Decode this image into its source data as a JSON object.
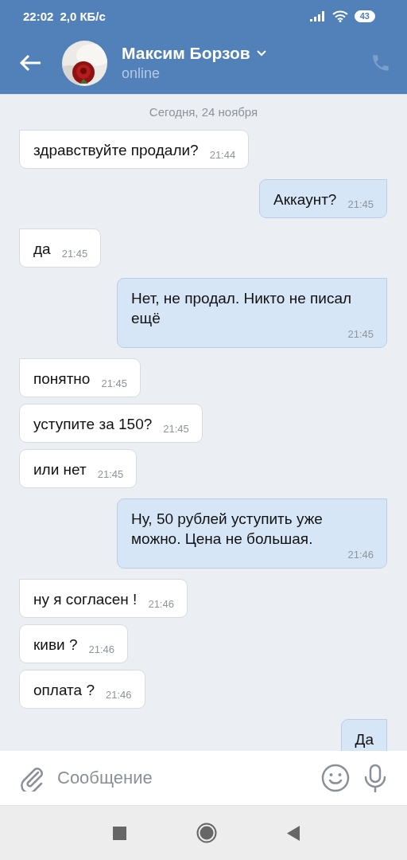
{
  "status_bar": {
    "time": "22:02",
    "speed": "2,0 КБ/с",
    "battery": "43"
  },
  "header": {
    "name": "Максим Борзов",
    "status": "online"
  },
  "date_separator": "Сегодня, 24 ноября",
  "messages": [
    {
      "kind": "incoming",
      "tail": true,
      "text": "здравствуйте продали?",
      "time": "21:44"
    },
    {
      "kind": "outgoing",
      "tail": true,
      "text": "Аккаунт?",
      "time": "21:45"
    },
    {
      "kind": "incoming",
      "tail": true,
      "text": "да",
      "time": "21:45"
    },
    {
      "kind": "outgoing",
      "tail": true,
      "text": "Нет, не продал. Никто не писал ещё",
      "time": "21:45"
    },
    {
      "kind": "incoming",
      "tail": true,
      "text": "понятно",
      "time": "21:45"
    },
    {
      "kind": "incoming",
      "tail": false,
      "text": "уступите за 150?",
      "time": "21:45"
    },
    {
      "kind": "incoming",
      "tail": false,
      "text": "или нет",
      "time": "21:45"
    },
    {
      "kind": "outgoing",
      "tail": true,
      "text": "Ну, 50 рублей уступить уже можно. Цена не большая.",
      "time": "21:46"
    },
    {
      "kind": "incoming",
      "tail": true,
      "text": "ну я согласен !",
      "time": "21:46"
    },
    {
      "kind": "incoming",
      "tail": false,
      "text": "киви ?",
      "time": "21:46"
    },
    {
      "kind": "incoming",
      "tail": false,
      "text": "оплата ?",
      "time": "21:46"
    },
    {
      "kind": "outgoing",
      "tail": true,
      "text": "Да"
    }
  ],
  "composer": {
    "placeholder": "Сообщение"
  }
}
